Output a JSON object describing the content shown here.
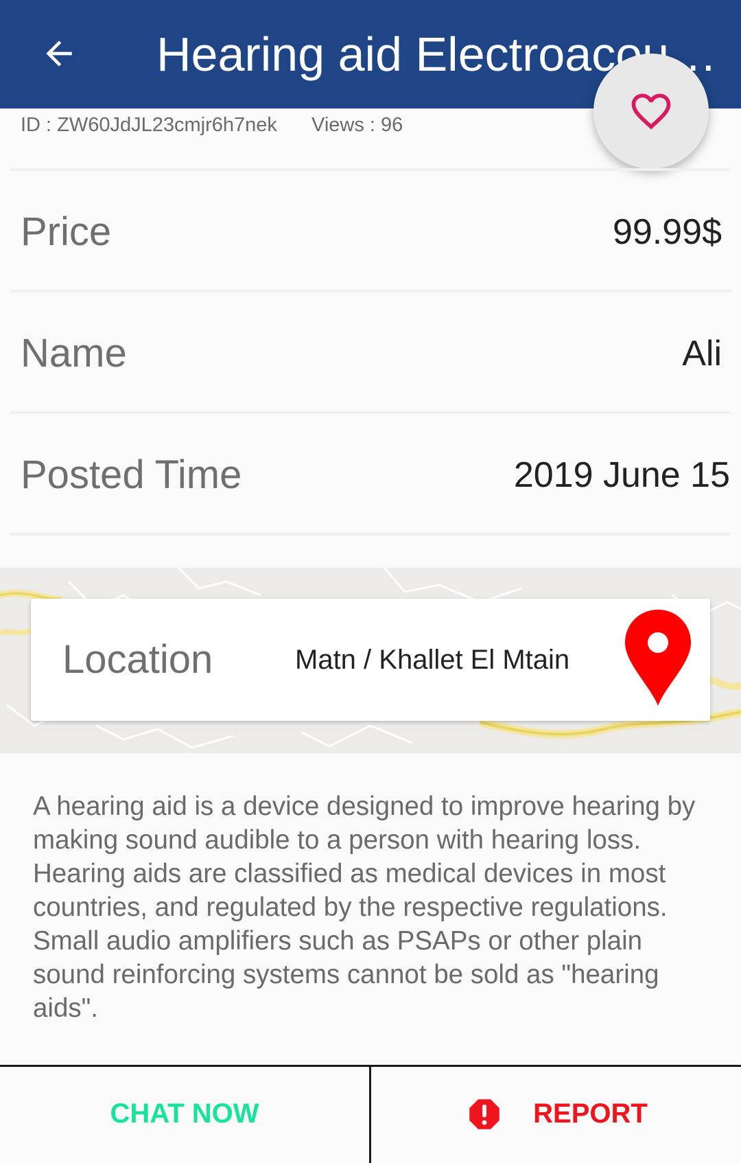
{
  "app_bar": {
    "title": "Hearing aid   Electroacoustic hearing aid"
  },
  "meta": {
    "id_text": "ID : ZW60JdJL23cmjr6h7nek",
    "views_text": "Views : 96"
  },
  "details": [
    {
      "label": "Price",
      "value": "99.99$"
    },
    {
      "label": "Name",
      "value": "Ali"
    },
    {
      "label": "Posted Time",
      "value": "2019 June 15"
    }
  ],
  "location": {
    "label": "Location",
    "value": "Matn / Khallet El Mtain"
  },
  "description": "A hearing aid is a device designed to improve hearing by making sound audible to a person with hearing loss. Hearing aids are classified as medical devices in most countries, and regulated by the respective regulations. Small audio amplifiers such as PSAPs or other plain sound reinforcing systems cannot be sold as \"hearing aids\".",
  "actions": {
    "chat_label": "CHAT NOW",
    "report_label": "REPORT"
  },
  "colors": {
    "app_bar": "#1f4586",
    "chat": "#19e39a",
    "report": "#f0141e",
    "heart": "#d81b60",
    "pin": "#ff0000"
  },
  "icons": {
    "back": "arrow-left-icon",
    "favorite": "heart-outline-icon",
    "location": "map-pin-icon",
    "report": "alert-octagon-icon"
  }
}
